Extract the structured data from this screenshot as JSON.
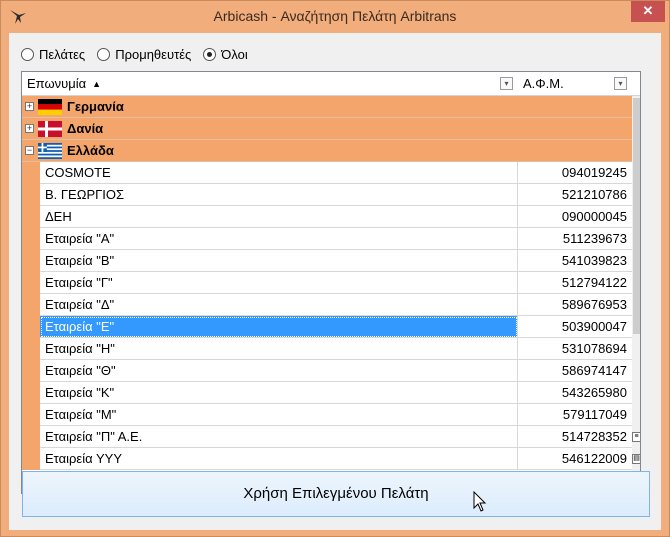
{
  "window": {
    "title": "Arbicash - Αναζήτηση Πελάτη Arbitrans",
    "close_glyph": "✕",
    "icon": "bird-icon"
  },
  "filter": {
    "options": [
      {
        "label": "Πελάτες",
        "selected": false
      },
      {
        "label": "Προμηθευτές",
        "selected": false
      },
      {
        "label": "Όλοι",
        "selected": true
      }
    ]
  },
  "grid": {
    "columns": [
      {
        "label": "Επωνυμία",
        "sort": "▲",
        "filter_glyph": "▾"
      },
      {
        "label": "Α.Φ.Μ.",
        "filter_glyph": "▾"
      }
    ],
    "groups": [
      {
        "name": "Γερμανία",
        "expander": "+",
        "expanded": false,
        "flag": "germany-flag-icon"
      },
      {
        "name": "Δανία",
        "expander": "+",
        "expanded": false,
        "flag": "denmark-flag-icon"
      },
      {
        "name": "Ελλάδα",
        "expander": "−",
        "expanded": true,
        "flag": "greece-flag-icon"
      }
    ],
    "rows": [
      {
        "name": "COSMOTE",
        "afm": "094019245"
      },
      {
        "name": "Β. ΓΕΩΡΓΙΟΣ",
        "afm": "521210786"
      },
      {
        "name": "ΔΕΗ",
        "afm": "090000045"
      },
      {
        "name": "Εταιρεία \"Α\"",
        "afm": "511239673"
      },
      {
        "name": "Εταιρεία \"Β\"",
        "afm": "541039823"
      },
      {
        "name": "Εταιρεία \"Γ\"",
        "afm": "512794122"
      },
      {
        "name": "Εταιρεία \"Δ\"",
        "afm": "589676953"
      },
      {
        "name": "Εταιρεία \"Ε\"",
        "afm": "503900047",
        "selected": true
      },
      {
        "name": "Εταιρεία \"Η\"",
        "afm": "531078694"
      },
      {
        "name": "Εταιρεία \"Θ\"",
        "afm": "586974147"
      },
      {
        "name": "Εταιρεία \"Κ\"",
        "afm": "543265980"
      },
      {
        "name": "Εταιρεία \"Μ\"",
        "afm": "579117049"
      },
      {
        "name": "Εταιρεία \"Π\" Α.Ε.",
        "afm": "514728352"
      },
      {
        "name": "Εταιρεία ΥΥΥ",
        "afm": "546122009"
      }
    ]
  },
  "actions": {
    "use_selected_label": "Χρήση Επιλεγμένου Πελάτη"
  },
  "colors": {
    "accent": "#f4a56c",
    "selection": "#3399ff",
    "close": "#c75050"
  }
}
